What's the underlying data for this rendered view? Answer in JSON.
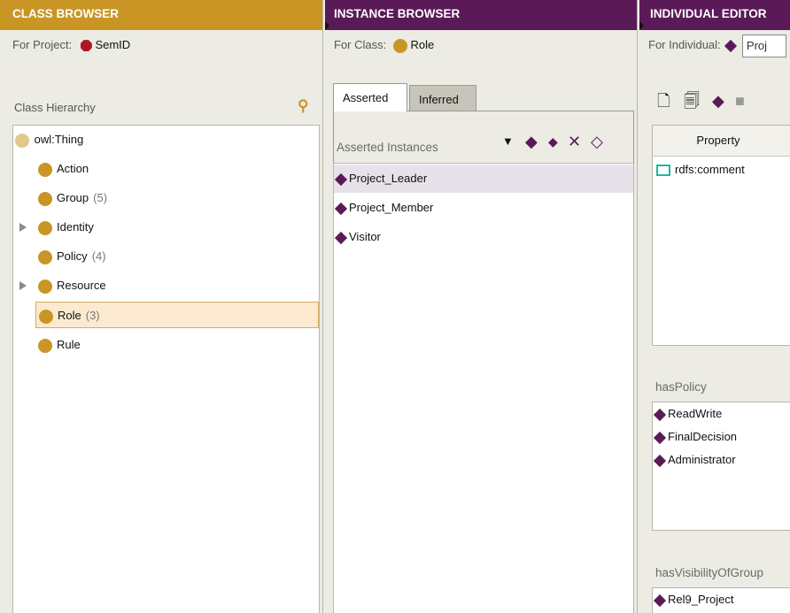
{
  "class_browser": {
    "header": "CLASS BROWSER",
    "project_label": "For Project:",
    "project_name": "SemID",
    "hierarchy_title": "Class Hierarchy",
    "root": "owl:Thing",
    "classes": [
      {
        "name": "Action",
        "count": "",
        "expandable": false
      },
      {
        "name": "Group",
        "count": "(5)",
        "expandable": false
      },
      {
        "name": "Identity",
        "count": "",
        "expandable": true
      },
      {
        "name": "Policy",
        "count": "(4)",
        "expandable": false
      },
      {
        "name": "Resource",
        "count": "",
        "expandable": true
      },
      {
        "name": "Role",
        "count": "(3)",
        "expandable": false,
        "selected": true
      },
      {
        "name": "Rule",
        "count": "",
        "expandable": false
      }
    ]
  },
  "instance_browser": {
    "header": "INSTANCE BROWSER",
    "class_label": "For Class:",
    "class_name": "Role",
    "tabs": [
      "Asserted",
      "Inferred"
    ],
    "active_tab": "Asserted",
    "list_title": "Asserted Instances",
    "instances": [
      "Project_Leader",
      "Project_Member",
      "Visitor"
    ],
    "selected_instance": "Project_Leader"
  },
  "individual_editor": {
    "header": "INDIVIDUAL EDITOR",
    "individual_label": "For Individual:",
    "individual_value": "Proj",
    "property_column": "Property",
    "properties": [
      "rdfs:comment"
    ],
    "has_policy_title": "hasPolicy",
    "has_policy": [
      "ReadWrite",
      "FinalDecision",
      "Administrator"
    ],
    "has_visibility_title": "hasVisibilityOfGroup",
    "has_visibility": [
      "Rel9_Project"
    ]
  },
  "colors": {
    "class_header": "#c99625",
    "instance_header": "#5a1a57",
    "class_icon": "#c99625",
    "instance_icon": "#5a1a57",
    "project_icon": "#b01525"
  }
}
